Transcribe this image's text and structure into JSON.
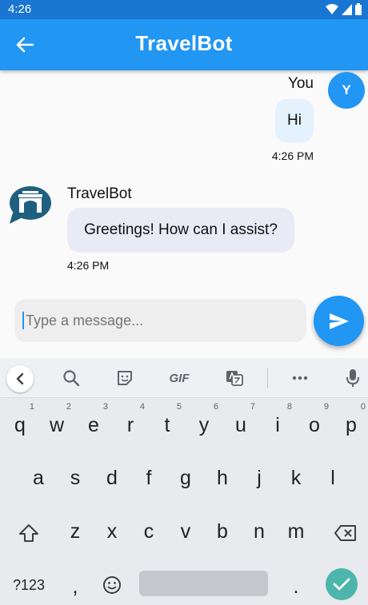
{
  "status_bar": {
    "time": "4:26"
  },
  "app_bar": {
    "title": "TravelBot"
  },
  "messages": {
    "user": {
      "avatar_initial": "Y",
      "sender": "You",
      "text": "Hi",
      "time": "4:26 PM"
    },
    "bot": {
      "sender": "TravelBot",
      "text": "Greetings! How can I assist?",
      "time": "4:26 PM"
    }
  },
  "composer": {
    "placeholder": "Type a message..."
  },
  "keyboard": {
    "row1": [
      {
        "key": "q",
        "hint": "1"
      },
      {
        "key": "w",
        "hint": "2"
      },
      {
        "key": "e",
        "hint": "3"
      },
      {
        "key": "r",
        "hint": "4"
      },
      {
        "key": "t",
        "hint": "5"
      },
      {
        "key": "y",
        "hint": "6"
      },
      {
        "key": "u",
        "hint": "7"
      },
      {
        "key": "i",
        "hint": "8"
      },
      {
        "key": "o",
        "hint": "9"
      },
      {
        "key": "p",
        "hint": "0"
      }
    ],
    "row2": [
      "a",
      "s",
      "d",
      "f",
      "g",
      "h",
      "j",
      "k",
      "l"
    ],
    "row3": [
      "z",
      "x",
      "c",
      "v",
      "b",
      "n",
      "m"
    ],
    "symbols_label": "?123",
    "comma": ",",
    "period": ".",
    "toolbar_gif": "GIF"
  },
  "colors": {
    "primary": "#2196f3",
    "status_bar": "#1976d2",
    "enter_key": "#4db6ac"
  }
}
